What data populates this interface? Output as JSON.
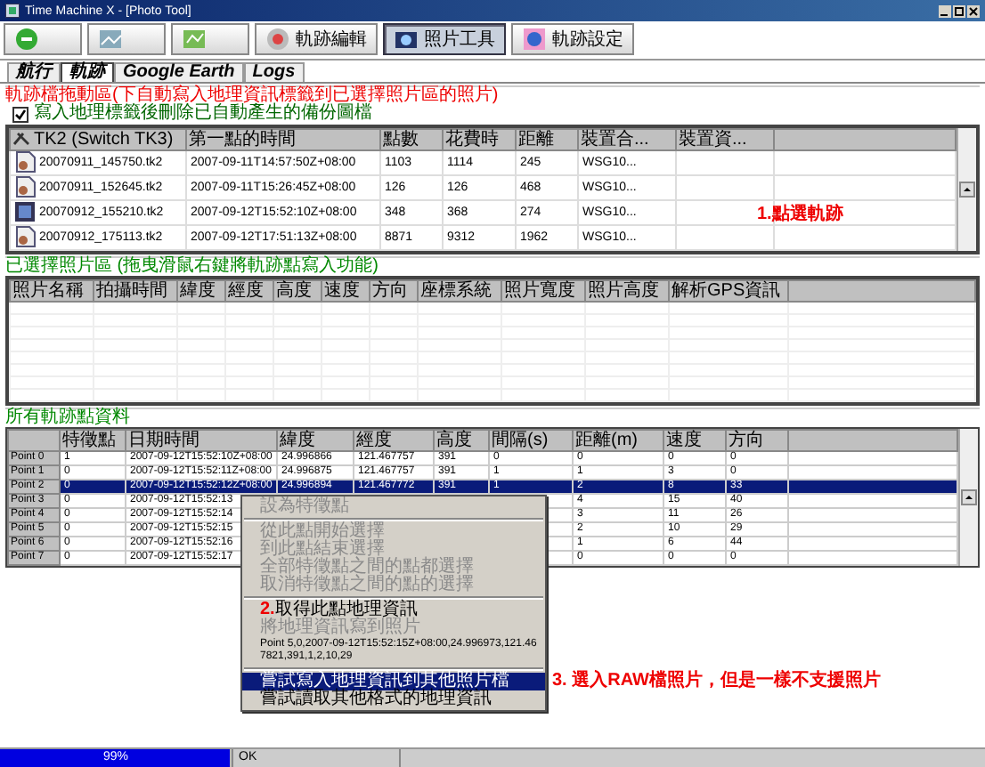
{
  "window": {
    "title": "Time Machine X - [Photo Tool]"
  },
  "toolbar": [
    {
      "selected": false
    },
    {
      "selected": false
    },
    {
      "selected": false
    },
    {
      "label": "軌跡編輯",
      "selected": false
    },
    {
      "label": "照片工具",
      "selected": true
    },
    {
      "label": "軌跡設定",
      "selected": false
    }
  ],
  "tabs": [
    {
      "label": "航行",
      "selected": false
    },
    {
      "label": "軌跡",
      "selected": true
    },
    {
      "label": "Google Earth",
      "selected": false
    },
    {
      "label": "Logs",
      "selected": false
    }
  ],
  "track_section": {
    "title": "軌跡檔拖動區(下自動寫入地理資訊標籤到已選擇照片區的照片)",
    "checkbox": {
      "label": "寫入地理標籤後刪除已自動產生的備份圖檔",
      "checked": true
    },
    "columns": [
      "TK2 (Switch TK3)",
      "第一點的時間",
      "點數",
      "花費時",
      "距離",
      "裝置合...",
      "裝置資..."
    ],
    "rows": [
      {
        "selected": false,
        "cells": [
          "20070911_145750.tk2",
          "2007-09-11T14:57:50Z+08:00",
          "1103",
          "1114",
          "245",
          "WSG10..."
        ]
      },
      {
        "selected": false,
        "cells": [
          "20070911_152645.tk2",
          "2007-09-11T15:26:45Z+08:00",
          "126",
          "126",
          "468",
          "WSG10..."
        ]
      },
      {
        "selected": true,
        "cells": [
          "20070912_155210.tk2",
          "2007-09-12T15:52:10Z+08:00",
          "348",
          "368",
          "274",
          "WSG10..."
        ]
      },
      {
        "selected": false,
        "cells": [
          "20070912_175113.tk2",
          "2007-09-12T17:51:13Z+08:00",
          "8871",
          "9312",
          "1962",
          "WSG10..."
        ]
      }
    ],
    "annotation": "1.點選軌跡"
  },
  "photo_section": {
    "title": "已選擇照片區 (拖曳滑鼠右鍵將軌跡點寫入功能)",
    "columns": [
      "照片名稱",
      "拍攝時間",
      "緯度",
      "經度",
      "高度",
      "速度",
      "方向",
      "座標系統",
      "照片寬度",
      "照片高度",
      "解析GPS資訊"
    ]
  },
  "points_section": {
    "title": "所有軌跡點資料",
    "columns": [
      "特徵點",
      "日期時間",
      "緯度",
      "經度",
      "高度",
      "間隔(s)",
      "距離(m)",
      "速度",
      "方向"
    ],
    "rows": [
      {
        "label": "Point 0",
        "selected": false,
        "cells": [
          "1",
          "2007-09-12T15:52:10Z+08:00",
          "24.996866",
          "121.467757",
          "391",
          "0",
          "0",
          "0",
          "0"
        ]
      },
      {
        "label": "Point 1",
        "selected": false,
        "cells": [
          "0",
          "2007-09-12T15:52:11Z+08:00",
          "24.996875",
          "121.467757",
          "391",
          "1",
          "1",
          "3",
          "0"
        ]
      },
      {
        "label": "Point 2",
        "selected": true,
        "cells": [
          "0",
          "2007-09-12T15:52:12Z+08:00",
          "24.996894",
          "121.467772",
          "391",
          "1",
          "2",
          "8",
          "33"
        ]
      },
      {
        "label": "Point 3",
        "selected": false,
        "cells": [
          "0",
          "2007-09-12T15:52:13"
        ],
        "tail": [
          "4",
          "15",
          "40"
        ]
      },
      {
        "label": "Point 4",
        "selected": false,
        "cells": [
          "0",
          "2007-09-12T15:52:14"
        ],
        "tail": [
          "3",
          "11",
          "26"
        ]
      },
      {
        "label": "Point 5",
        "selected": false,
        "cells": [
          "0",
          "2007-09-12T15:52:15"
        ],
        "tail": [
          "2",
          "10",
          "29"
        ]
      },
      {
        "label": "Point 6",
        "selected": false,
        "cells": [
          "0",
          "2007-09-12T15:52:16"
        ],
        "tail": [
          "1",
          "6",
          "44"
        ]
      },
      {
        "label": "Point 7",
        "selected": false,
        "cells": [
          "0",
          "2007-09-12T15:52:17"
        ],
        "tail": [
          "0",
          "0",
          "0"
        ]
      }
    ]
  },
  "context_menu": {
    "items": [
      {
        "kind": "item",
        "label": "設為特徵點",
        "disabled": true,
        "highlighted": false
      },
      {
        "kind": "separator"
      },
      {
        "kind": "item",
        "label": "從此點開始選擇",
        "disabled": true,
        "highlighted": false
      },
      {
        "kind": "item",
        "label": "到此點結束選擇",
        "disabled": true,
        "highlighted": false
      },
      {
        "kind": "item",
        "label": "全部特徵點之間的點都選擇",
        "disabled": true,
        "highlighted": false
      },
      {
        "kind": "item",
        "label": "取消特徵點之間的點的選擇",
        "disabled": true,
        "highlighted": false
      },
      {
        "kind": "separator"
      },
      {
        "kind": "item",
        "note": "2.",
        "label": "取得此點地理資訊",
        "disabled": false,
        "highlighted": false
      },
      {
        "kind": "item",
        "label": "將地理資訊寫到照片",
        "disabled": true,
        "highlighted": false
      },
      {
        "kind": "info",
        "label": "Point 5,0,2007-09-12T15:52:15Z+08:00,24.996973,121.467821,391,1,2,10,29",
        "disabled": false,
        "highlighted": false
      },
      {
        "kind": "separator"
      },
      {
        "kind": "item",
        "label": "嘗試寫入地理資訊到其他照片檔",
        "disabled": false,
        "highlighted": true
      },
      {
        "kind": "item",
        "label": "嘗試讀取其他格式的地理資訊",
        "disabled": false,
        "highlighted": false
      }
    ],
    "annotation": "3. 選入RAW檔照片，但是一樣不支援照片"
  },
  "status_bar": {
    "progress": {
      "level": 0.99,
      "reading": "99%"
    },
    "message": "OK"
  }
}
